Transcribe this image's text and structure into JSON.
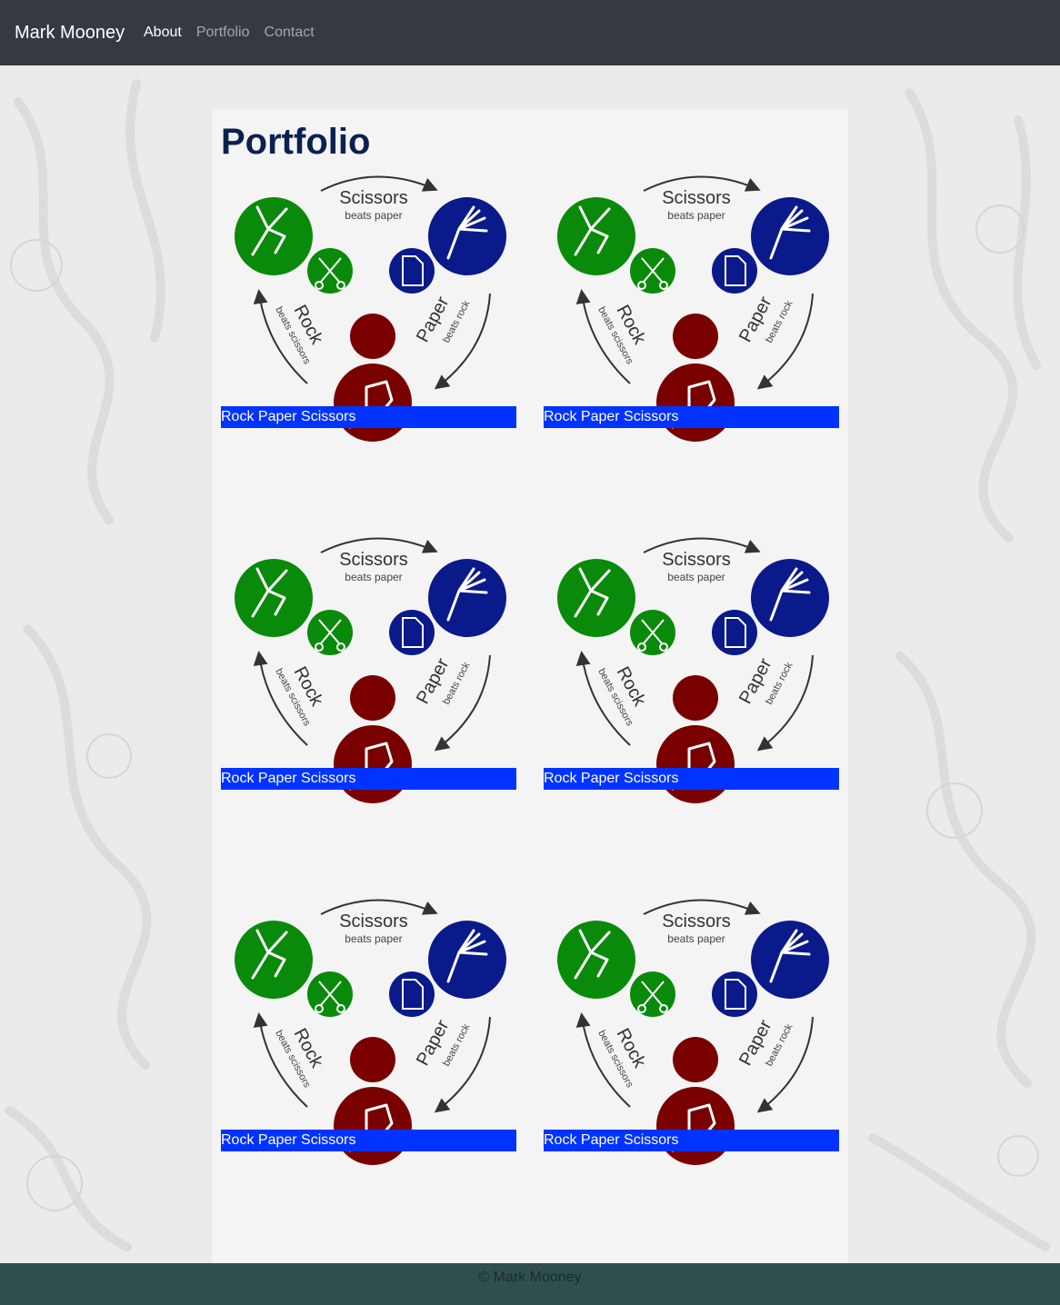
{
  "navbar": {
    "brand": "Mark Mooney",
    "links": [
      {
        "label": "About",
        "active": true
      },
      {
        "label": "Portfolio",
        "active": false
      },
      {
        "label": "Contact",
        "active": false
      }
    ]
  },
  "main": {
    "title": "Portfolio",
    "image_text": {
      "scissors": "Scissors",
      "scissors_sub": "beats paper",
      "rock": "Rock",
      "rock_sub": "beats scissors",
      "paper": "Paper",
      "paper_sub": "beats rock"
    },
    "projects": [
      {
        "label": "Rock Paper Scissors"
      },
      {
        "label": "Rock Paper Scissors"
      },
      {
        "label": "Rock Paper Scissors"
      },
      {
        "label": "Rock Paper Scissors"
      },
      {
        "label": "Rock Paper Scissors"
      },
      {
        "label": "Rock Paper Scissors"
      }
    ]
  },
  "footer": {
    "text": "© Mark Mooney"
  },
  "colors": {
    "navbar": "#343a40",
    "scissors_green": "#0a8a0a",
    "paper_blue": "#0a1a8a",
    "rock_red": "#7a0000",
    "label_bg": "#0033ff",
    "footer": "#2f4f4f"
  },
  "icons": [
    "scissors-hand-icon",
    "scissors-icon",
    "paper-hand-icon",
    "document-icon",
    "fist-icon",
    "rock-icon"
  ]
}
